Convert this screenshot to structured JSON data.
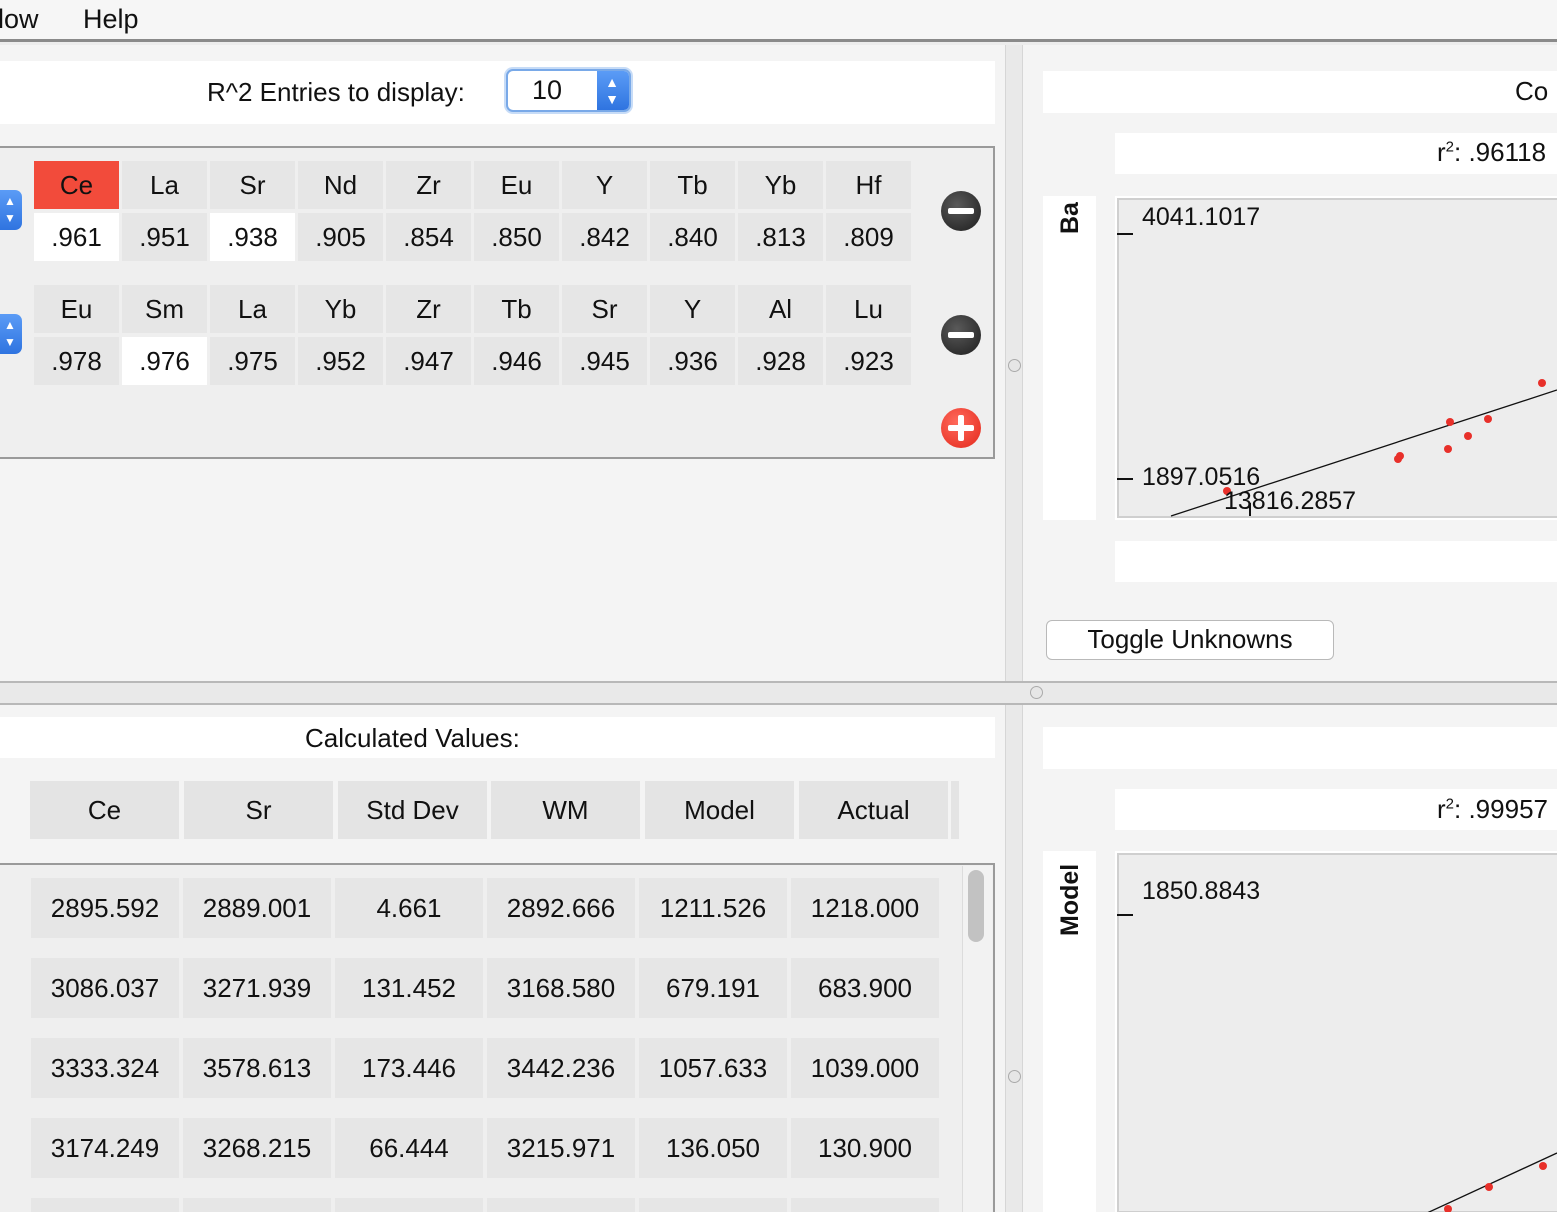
{
  "menu": {
    "items": [
      "low",
      "Help"
    ]
  },
  "r2_panel": {
    "entries_label": "R^2 Entries to display:",
    "entries_value": "10",
    "rows": [
      {
        "elements": [
          "Ce",
          "La",
          "Sr",
          "Nd",
          "Zr",
          "Eu",
          "Y",
          "Tb",
          "Yb",
          "Hf"
        ],
        "values": [
          ".961",
          ".951",
          ".938",
          ".905",
          ".854",
          ".850",
          ".842",
          ".840",
          ".813",
          ".809"
        ]
      },
      {
        "elements": [
          "Eu",
          "Sm",
          "La",
          "Yb",
          "Zr",
          "Tb",
          "Sr",
          "Y",
          "Al",
          "Lu"
        ],
        "values": [
          ".978",
          ".976",
          ".975",
          ".952",
          ".947",
          ".946",
          ".945",
          ".936",
          ".928",
          ".923"
        ]
      }
    ]
  },
  "correlation_plot": {
    "title_partial": "Co",
    "r2_label": ": .96118",
    "r2_prefix": "r",
    "r2_sup": "2",
    "y_axis_label": "Ba",
    "y_max": "4041.1017",
    "y_min": "1897.0516",
    "x_min": "13816.2857"
  },
  "toggle_button": {
    "label": "Toggle Unknowns"
  },
  "calculated": {
    "title": "Calculated Values:",
    "columns": [
      "Ce",
      "Sr",
      "Std Dev",
      "WM",
      "Model",
      "Actual"
    ],
    "rows": [
      [
        "2895.592",
        "2889.001",
        "4.661",
        "2892.666",
        "1211.526",
        "1218.000"
      ],
      [
        "3086.037",
        "3271.939",
        "131.452",
        "3168.580",
        "679.191",
        "683.900"
      ],
      [
        "3333.324",
        "3578.613",
        "173.446",
        "3442.236",
        "1057.633",
        "1039.000"
      ],
      [
        "3174.249",
        "3268.215",
        "66.444",
        "3215.971",
        "136.050",
        "130.900"
      ]
    ]
  },
  "model_plot": {
    "r2_label": ": .99957",
    "r2_prefix": "r",
    "r2_sup": "2",
    "y_axis_label": "Model",
    "y_max": "1850.8843"
  },
  "colors": {
    "accent": "#2f74e0",
    "highlight": "#f24b3b",
    "point": "#e8302a"
  }
}
